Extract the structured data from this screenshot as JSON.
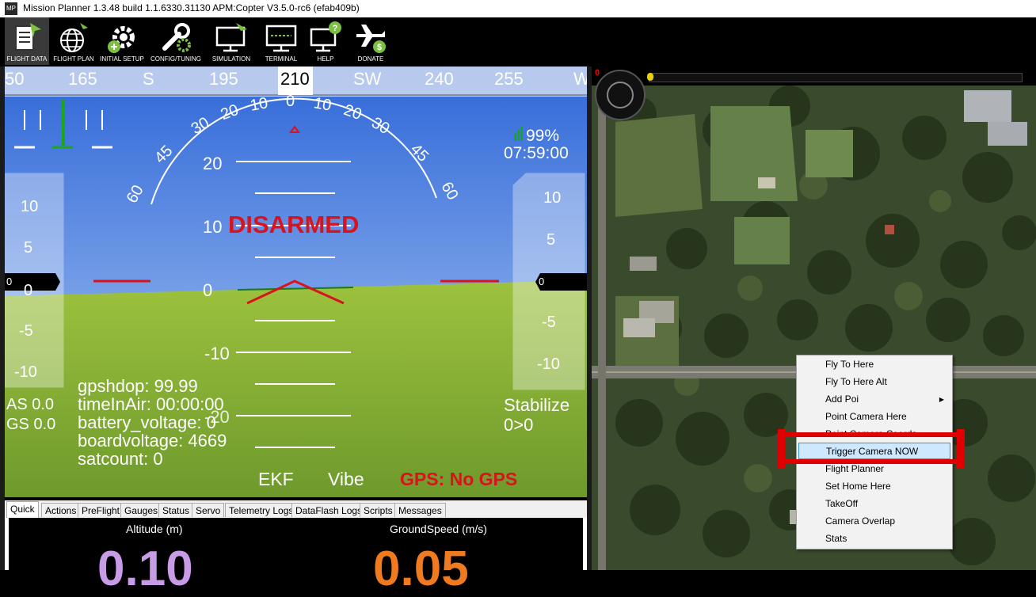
{
  "window": {
    "title": "Mission Planner 1.3.48 build 1.1.6330.31130 APM:Copter V3.5.0-rc6 (efab409b)",
    "icon_text": "MP"
  },
  "toolbar": {
    "items": [
      {
        "label": "FLIGHT DATA",
        "icon": "flight-data-icon"
      },
      {
        "label": "FLIGHT PLAN",
        "icon": "flight-plan-icon"
      },
      {
        "label": "INITIAL SETUP",
        "icon": "initial-setup-icon"
      },
      {
        "label": "CONFIG/TUNING",
        "icon": "config-tuning-icon"
      },
      {
        "label": "SIMULATION",
        "icon": "simulation-icon"
      },
      {
        "label": "TERMINAL",
        "icon": "terminal-icon"
      },
      {
        "label": "HELP",
        "icon": "help-icon"
      },
      {
        "label": "DONATE",
        "icon": "donate-icon"
      }
    ]
  },
  "hud": {
    "heading_tape": [
      "50",
      "165",
      "S",
      "195",
      "210",
      "SW",
      "240",
      "255",
      "W"
    ],
    "heading_current": "210",
    "roll_scale": [
      "60",
      "45",
      "30",
      "20",
      "10",
      "0",
      "10",
      "20",
      "30",
      "45",
      "60"
    ],
    "pitch_labels": [
      "20",
      "10",
      "0",
      "-10",
      "-20"
    ],
    "status": "DISARMED",
    "battery_percent": "99%",
    "clock": "07:59:00",
    "speed_scale": [
      "10",
      "5",
      "0",
      "-5",
      "-10"
    ],
    "speed_value": "0",
    "alt_scale": [
      "10",
      "5",
      "-5",
      "-10"
    ],
    "alt_value": "0",
    "airspeed": "AS 0.0",
    "groundspeed": "GS 0.0",
    "info_lines": [
      "gpshdop: 99.99",
      "timeInAir: 00:00:00",
      "battery_voltage: 0",
      "boardvoltage: 4669",
      "satcount: 0"
    ],
    "mode": "Stabilize",
    "wp": "0>0",
    "ekf": "EKF",
    "vibe": "Vibe",
    "gps_status": "GPS: No GPS",
    "colors": {
      "sky": "#7da6e6",
      "ground": "#8cb43a",
      "alert": "#d8131d"
    }
  },
  "tabs": [
    "Quick",
    "Actions",
    "PreFlight",
    "Gauges",
    "Status",
    "Servo",
    "Telemetry Logs",
    "DataFlash Logs",
    "Scripts",
    "Messages"
  ],
  "active_tab": "Quick",
  "quick": {
    "altitude_label": "Altitude (m)",
    "altitude_value": "0.10",
    "groundspeed_label": "GroundSpeed (m/s)",
    "groundspeed_value": "0.05",
    "colors": {
      "altitude": "#c89be6",
      "groundspeed": "#f07a20"
    }
  },
  "map": {
    "indicator_value": "0"
  },
  "context_menu": {
    "items": [
      {
        "label": "Fly To Here"
      },
      {
        "label": "Fly To Here Alt"
      },
      {
        "label": "Add Poi",
        "submenu": true
      },
      {
        "label": "Point Camera Here"
      },
      {
        "label": "Point Camera Coords"
      },
      {
        "label": "Trigger Camera NOW",
        "selected": true
      },
      {
        "label": "Flight Planner"
      },
      {
        "label": "Set Home Here"
      },
      {
        "label": "TakeOff"
      },
      {
        "label": "Camera Overlap"
      },
      {
        "label": "Stats"
      }
    ]
  }
}
